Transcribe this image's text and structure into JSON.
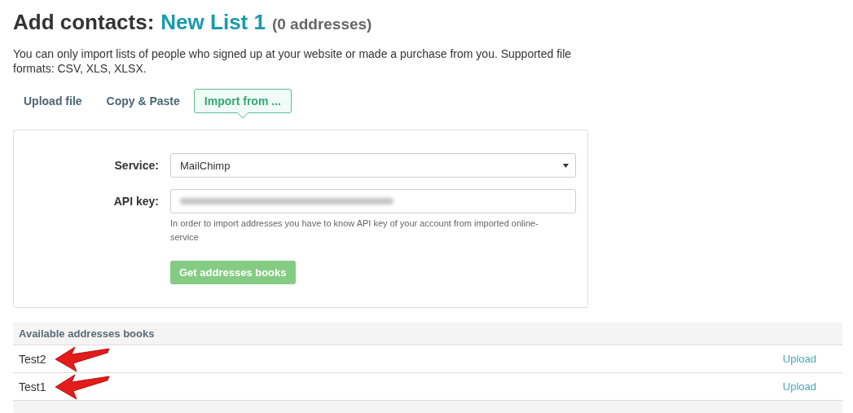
{
  "heading": {
    "title": "Add contacts:",
    "list_name": "New List 1",
    "count": "(0 addresses)"
  },
  "description": "You can only import lists of people who signed up at your website or made a purchase from you. Supported file formats: CSV, XLS, XLSX.",
  "tabs": [
    {
      "label": "Upload file",
      "selected": false
    },
    {
      "label": "Copy & Paste",
      "selected": false
    },
    {
      "label": "Import from ...",
      "selected": true
    }
  ],
  "form": {
    "service": {
      "label": "Service:",
      "value": "MailChimp"
    },
    "api_key": {
      "label": "API key:",
      "blurred": true,
      "hint": "In order to import addresses you have to know API key of your account from imported online-service"
    },
    "button": "Get addresses books"
  },
  "books": {
    "header": "Available addresses books",
    "rows": [
      {
        "name": "Test2",
        "action": "Upload",
        "arrow": true
      },
      {
        "name": "Test1",
        "action": "Upload",
        "arrow": true
      }
    ]
  }
}
